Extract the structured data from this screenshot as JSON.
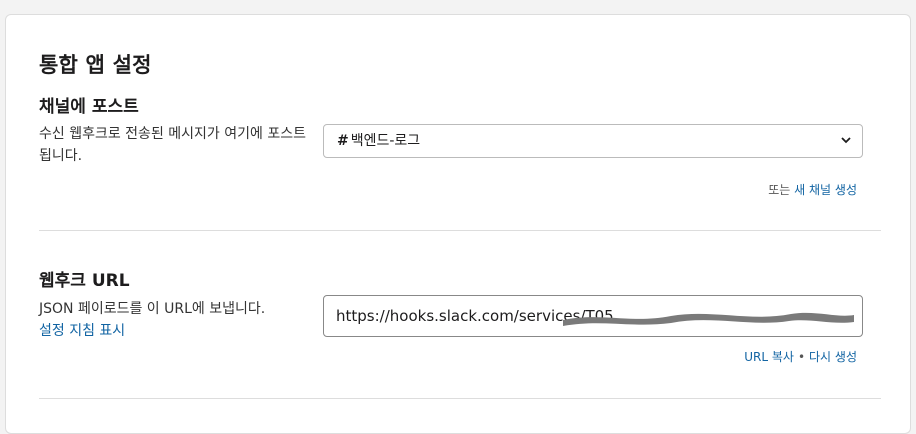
{
  "page": {
    "title": "통합 앱 설정"
  },
  "channel_section": {
    "heading": "채널에 포스트",
    "description": "수신 웹후크로 전송된 메시지가 여기에 포스트됩니다.",
    "select_hash": "#",
    "select_value": "백엔드-로그",
    "helper_prefix": "또는",
    "helper_link": "새 채널 생성"
  },
  "webhook_section": {
    "heading": "웹후크 URL",
    "description": "JSON 페이로드를 이 URL에 보냅니다.",
    "instructions_link": "설정 지침 표시",
    "url_visible": "https://hooks.slack.com/services/T05",
    "copy_link": "URL 복사",
    "regenerate_link": "다시 생성"
  },
  "icons": {
    "select_chevron": "chevron-down-icon"
  },
  "colors": {
    "link": "#1264a3",
    "redaction": "#7a7a7a"
  }
}
